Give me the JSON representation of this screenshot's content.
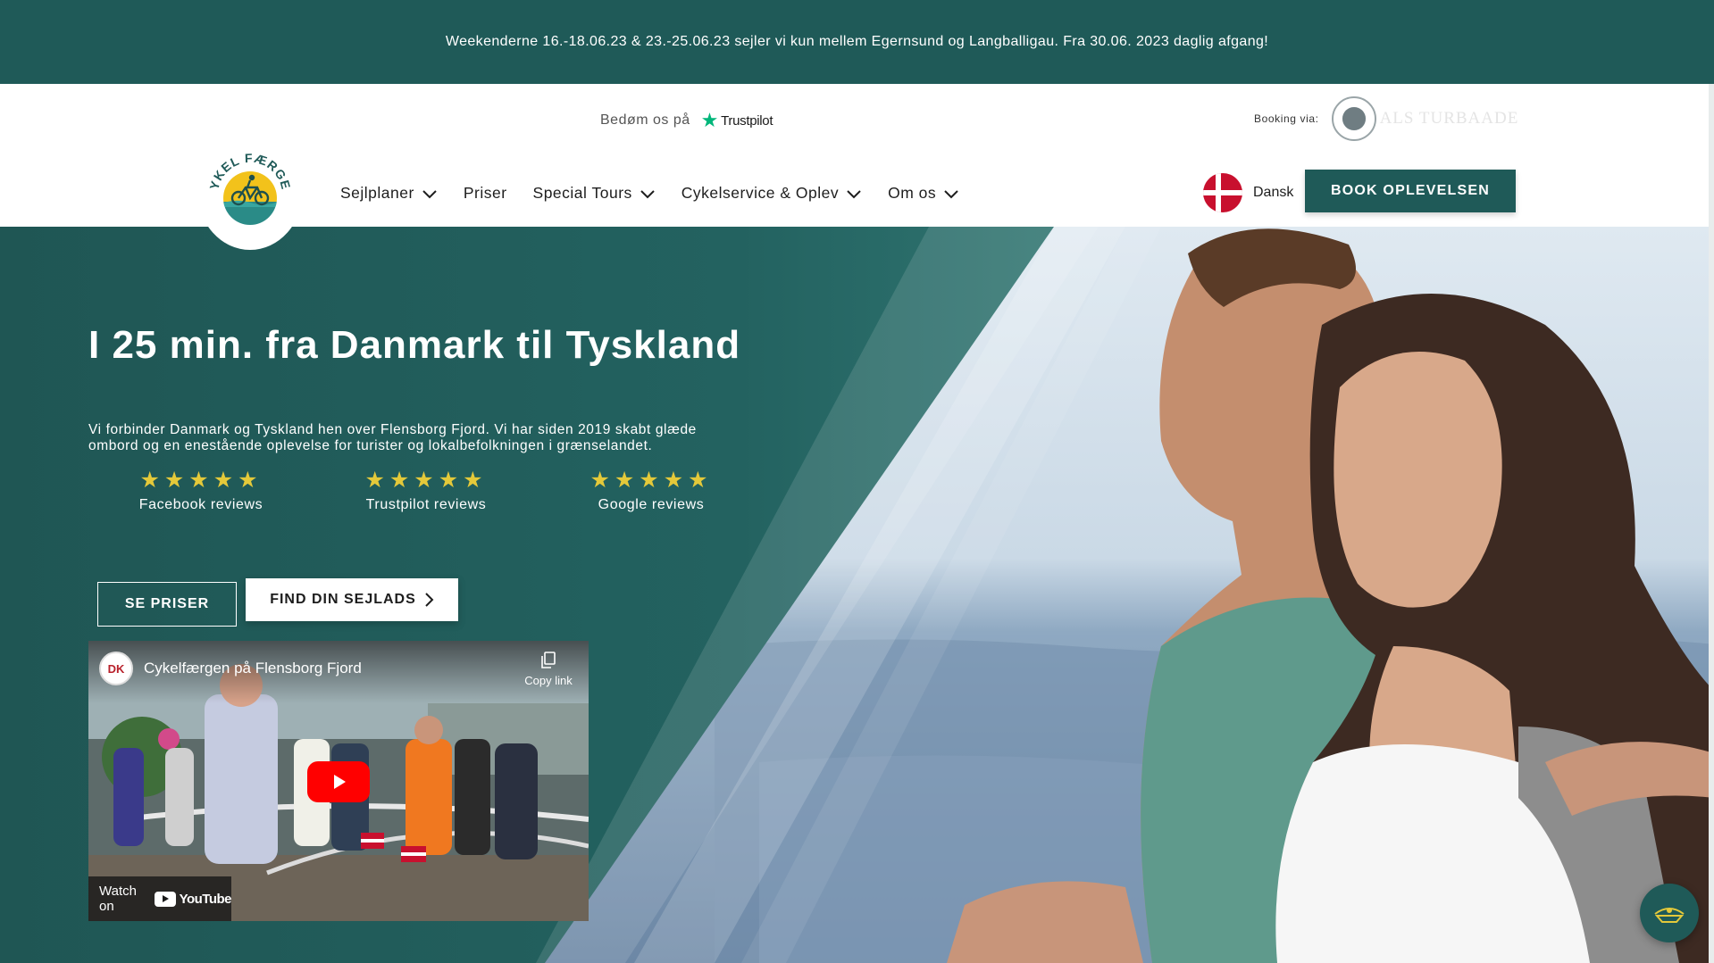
{
  "announcement": {
    "text": "Weekenderne 16.-18.06.23 & 23.-25.06.23 sejler vi kun mellem Egernsund og Langballigau. Fra 30.06. 2023 daglig afgang!"
  },
  "header": {
    "rate_us": "Bedøm os på",
    "trustpilot": "Trustpilot",
    "booking_via": "Booking via:",
    "booking_partner": "ALS TURBAADE",
    "logo_text": "CYKEL FÆRGEN",
    "nav": [
      {
        "label": "Sejlplaner",
        "has_dropdown": true
      },
      {
        "label": "Priser",
        "has_dropdown": false
      },
      {
        "label": "Special Tours",
        "has_dropdown": true
      },
      {
        "label": "Cykelservice & Oplev",
        "has_dropdown": true
      },
      {
        "label": "Om os",
        "has_dropdown": true
      }
    ],
    "language": "Dansk",
    "book_button": "BOOK OPLEVELSEN"
  },
  "hero": {
    "title": "I 25 min. fra Danmark til Tyskland",
    "description_line1": "Vi forbinder Danmark og Tyskland hen over Flensborg Fjord. Vi har siden 2019 skabt glæde",
    "description_line2": "ombord og en enestående oplevelse for turister og lokalbefolkningen i grænselandet.",
    "reviews": [
      {
        "stars": "★★★★★",
        "label": "Facebook reviews",
        "rating": 5
      },
      {
        "stars": "★★★★★",
        "label": "Trustpilot reviews",
        "rating": 5
      },
      {
        "stars": "★★★★★",
        "label": "Google reviews",
        "rating": 5
      }
    ],
    "btn_prices": "SE PRISER",
    "btn_find": "FIND DIN SEJLADS"
  },
  "video": {
    "channel_badge": "DK",
    "title": "Cykelfærgen på Flensborg Fjord",
    "copy_link": "Copy link",
    "watch_on": "Watch on",
    "youtube": "YouTube"
  },
  "colors": {
    "brand": "#1f5a58",
    "accent_star": "#e4c93a",
    "trustpilot_green": "#00b67a",
    "youtube_red": "#ff0000"
  },
  "icons": [
    "trustpilot-star-icon",
    "chevron-down-icon",
    "danish-flag-icon",
    "chevron-right-icon",
    "copy-icon",
    "play-icon",
    "youtube-icon",
    "chat-icon"
  ]
}
